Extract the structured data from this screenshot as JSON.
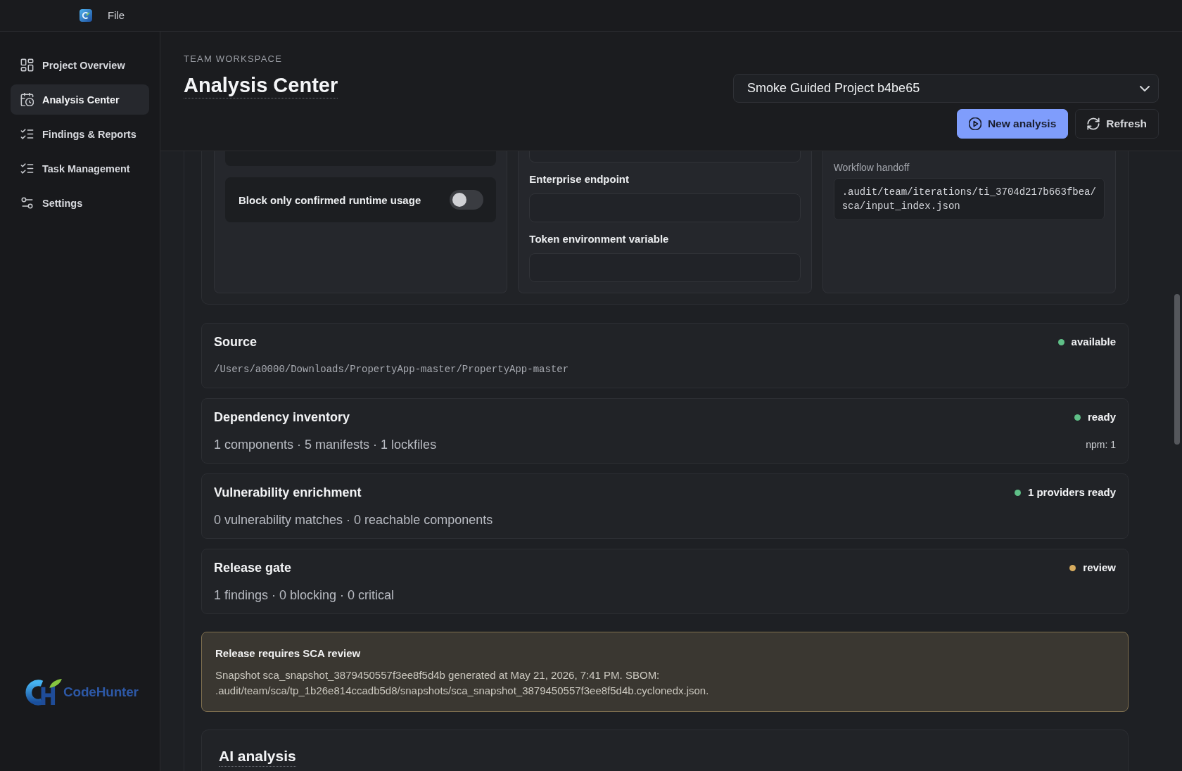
{
  "menu_bar": {
    "items": [
      "File"
    ]
  },
  "sidebar": {
    "items": [
      {
        "label": "Project Overview",
        "selected": false
      },
      {
        "label": "Analysis Center",
        "selected": true
      },
      {
        "label": "Findings & Reports",
        "selected": false
      },
      {
        "label": "Task Management",
        "selected": false
      },
      {
        "label": "Settings",
        "selected": false
      }
    ],
    "logo_text": "CodeHunter"
  },
  "header": {
    "eyebrow": "TEAM WORKSPACE",
    "title": "Analysis Center",
    "project_select": {
      "value": "Smoke Guided Project b4be65"
    },
    "buttons": [
      {
        "label": "New analysis",
        "kind": "primary"
      },
      {
        "label": "Refresh",
        "kind": "secondary"
      }
    ]
  },
  "settings_panel": {
    "runtime_rows": [
      {
        "kind": "clipped"
      },
      {
        "kind": "toggle",
        "label": "Block only confirmed runtime usage",
        "on": false
      }
    ],
    "provider_fields": [
      {
        "kind": "clipped"
      },
      {
        "kind": "input",
        "label": "Enterprise endpoint"
      },
      {
        "kind": "input",
        "label": "Token environment variable"
      }
    ],
    "handoff": {
      "label": "Workflow handoff",
      "path": ".audit/team/iterations/ti_3704d217b663fbea/sca/input_index.json"
    }
  },
  "status_cards": [
    {
      "title": "Source",
      "status": "available",
      "color": "#5fbf87",
      "kind": "path",
      "detail": "/Users/a0000/Downloads/PropertyApp-master/PropertyApp-master"
    },
    {
      "title": "Dependency inventory",
      "status": "ready",
      "color": "#5fbf87",
      "kind": "summary",
      "detail": "1 components · 5 manifests · 1 lockfiles",
      "note": "npm: 1"
    },
    {
      "title": "Vulnerability enrichment",
      "status": "1 providers ready",
      "color": "#5fbf87",
      "kind": "summary",
      "detail": "0 vulnerability matches · 0 reachable components"
    },
    {
      "title": "Release gate",
      "status": "review",
      "color": "#d6ab5e",
      "kind": "summary",
      "detail": "1 findings · 0 blocking · 0 critical"
    }
  ],
  "alert": {
    "title": "Release requires SCA review",
    "message": "Snapshot sca_snapshot_3879450557f3ee8f5d4b generated at May 21, 2026, 7:41 PM. SBOM: .audit/team/sca/tp_1b26e814ccadb5d8/snapshots/sca_snapshot_3879450557f3ee8f5d4b.cyclonedx.json."
  },
  "ai_analysis": {
    "title": "AI analysis"
  }
}
